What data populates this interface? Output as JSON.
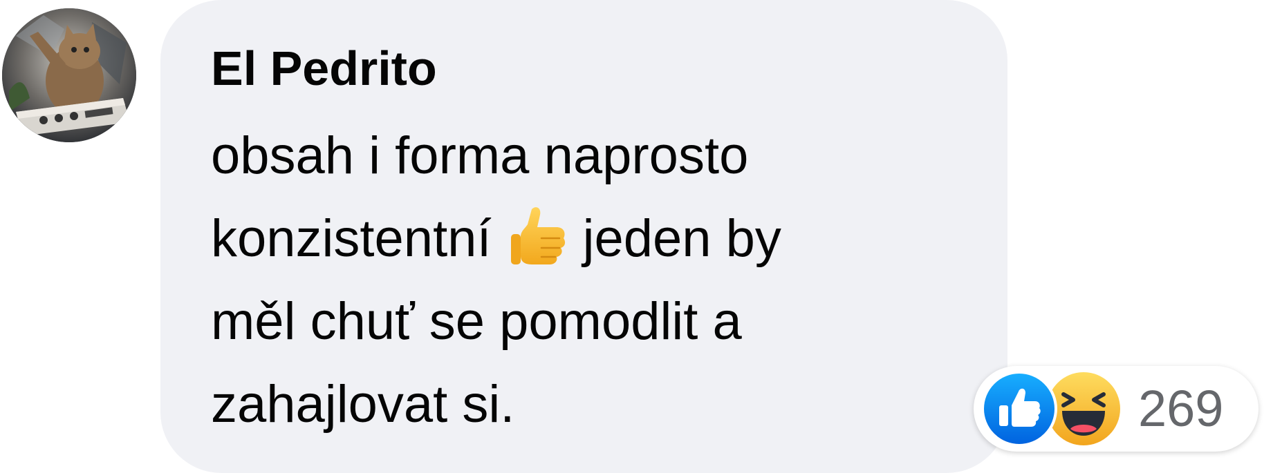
{
  "comment": {
    "author": "El Pedrito",
    "lines": [
      "obsah i forma naprosto",
      "konzistentní",
      "jeden by",
      "měl chuť se pomodlit a",
      "zahajlovat si."
    ],
    "inline_emoji": "thumbs-up"
  },
  "reactions": {
    "types": [
      "like",
      "haha"
    ],
    "count": "269"
  },
  "colors": {
    "bubble_bg": "#f0f1f5",
    "like_blue": "#1877f2",
    "haha_yellow": "#f7b125",
    "count_gray": "#65676b"
  }
}
